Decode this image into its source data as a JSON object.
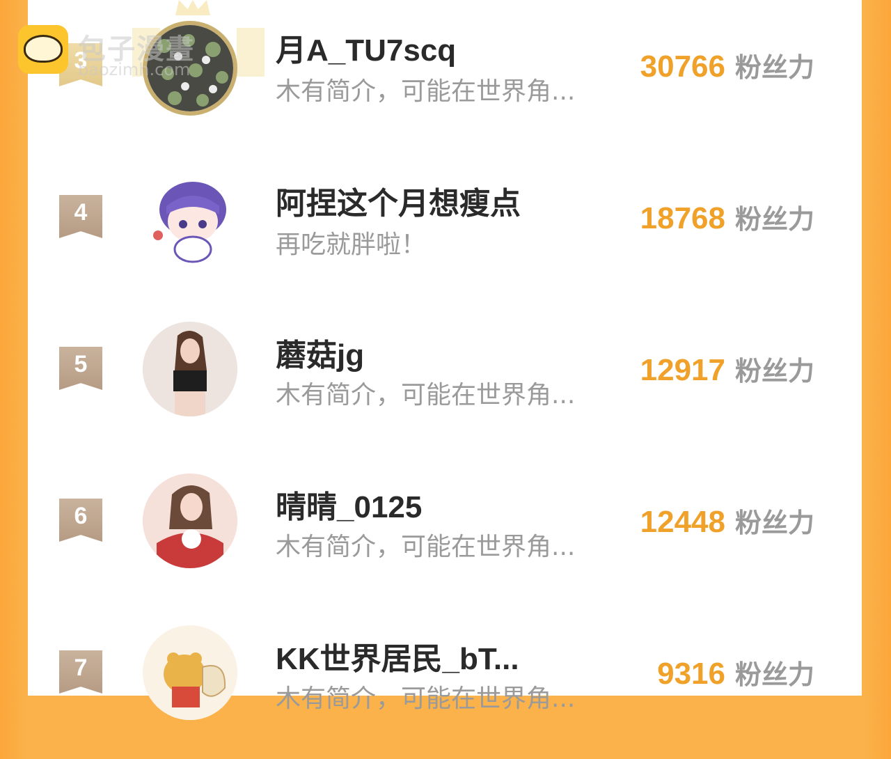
{
  "watermark": {
    "title": "包子漫畫",
    "subtitle": "baozimh.com"
  },
  "fans_unit": "粉丝力",
  "rows": [
    {
      "rank": "3",
      "name": "月A_TU7scq",
      "bio": "木有简介，可能在世界角...",
      "fans": "30766"
    },
    {
      "rank": "4",
      "name": "阿捏这个月想瘦点",
      "bio": "再吃就胖啦！",
      "fans": "18768"
    },
    {
      "rank": "5",
      "name": "蘑菇jg",
      "bio": "木有简介，可能在世界角...",
      "fans": "12917"
    },
    {
      "rank": "6",
      "name": "晴晴_0125",
      "bio": "木有简介，可能在世界角...",
      "fans": "12448"
    },
    {
      "rank": "7",
      "name": "KK世界居民_bT...",
      "bio": "木有简介，可能在世界角...",
      "fans": "9316"
    }
  ],
  "colors": {
    "accent": "#f0a12a",
    "frame": "#fbb24a",
    "badge": "#bda48d"
  }
}
